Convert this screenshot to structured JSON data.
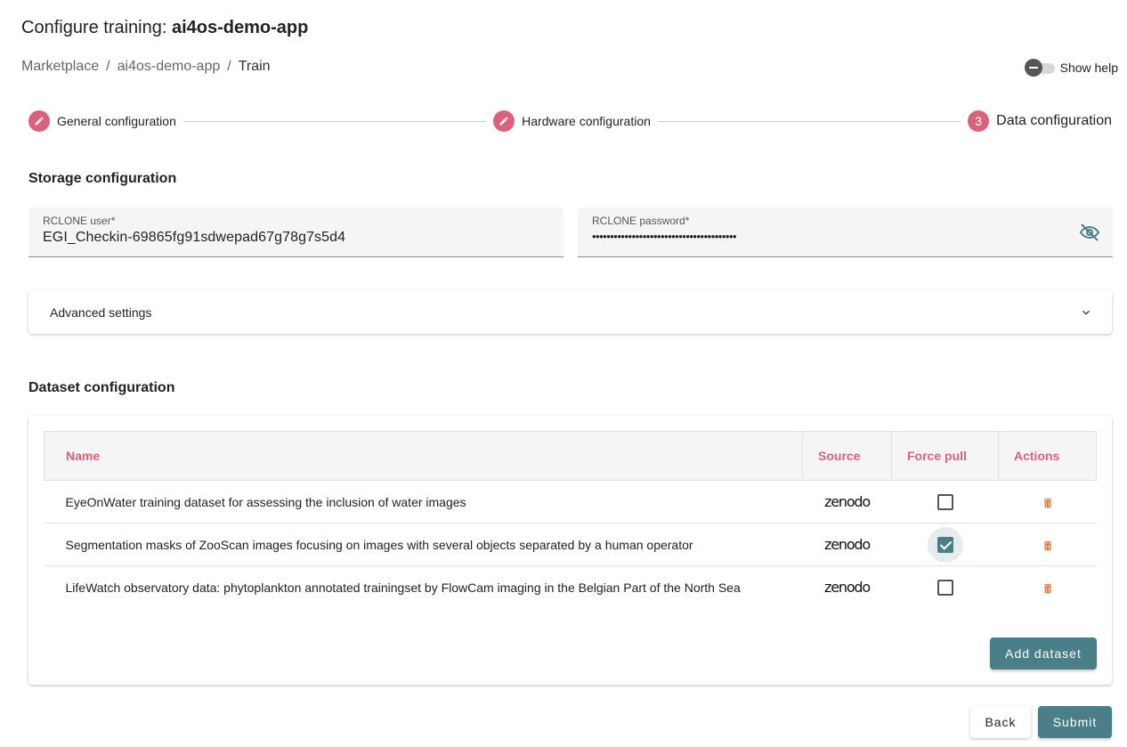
{
  "header": {
    "title_prefix": "Configure training: ",
    "title_app": "ai4os-demo-app"
  },
  "breadcrumb": {
    "items": [
      "Marketplace",
      "ai4os-demo-app",
      "Train"
    ],
    "separator": "/"
  },
  "help_toggle": {
    "label": "Show help",
    "on": false
  },
  "stepper": {
    "steps": [
      {
        "label": "General configuration",
        "icon": "pencil-icon"
      },
      {
        "label": "Hardware configuration",
        "icon": "pencil-icon"
      },
      {
        "label": "Data configuration",
        "number": "3"
      }
    ],
    "accent_color": "#d9627a"
  },
  "storage": {
    "title": "Storage configuration",
    "user_label": "RCLONE user*",
    "user_value": "EGI_Checkin-69865fg91sdwepad67g78g7s5d4",
    "password_label": "RCLONE password*",
    "password_value": "••••••••••••••••••••••••••••••••••••••••",
    "password_icon": "eye-off-icon"
  },
  "advanced": {
    "label": "Advanced settings"
  },
  "dataset": {
    "title": "Dataset configuration",
    "columns": [
      "Name",
      "Source",
      "Force pull",
      "Actions"
    ],
    "rows": [
      {
        "name": "EyeOnWater training dataset for assessing the inclusion of water images",
        "source": "zenodo",
        "force_pull": false
      },
      {
        "name": "Segmentation masks of ZooScan images focusing on images with several objects separated by a human operator",
        "source": "zenodo",
        "force_pull": true
      },
      {
        "name": "LifeWatch observatory data: phytoplankton annotated trainingset by FlowCam imaging in the Belgian Part of the North Sea",
        "source": "zenodo",
        "force_pull": false
      }
    ],
    "add_label": "Add dataset"
  },
  "footer": {
    "back_label": "Back",
    "submit_label": "Submit"
  },
  "colors": {
    "primary": "#4a7f8a",
    "accent": "#d9627a",
    "delete": "#e07a3c"
  }
}
